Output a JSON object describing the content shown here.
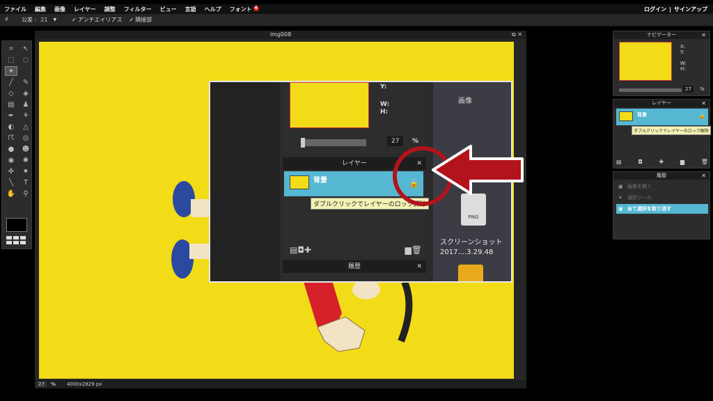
{
  "menu": {
    "items": [
      "ファイル",
      "編集",
      "画像",
      "レイヤー",
      "調整",
      "フィルター",
      "ビュー",
      "言語",
      "ヘルプ",
      "フォント"
    ],
    "font_badge": "4",
    "login": "ログイン",
    "separator": "|",
    "signup": "サインアップ"
  },
  "options": {
    "tolerance_label": "公差 :",
    "tolerance_value": "21",
    "antialias_label": "アンチエイリアス",
    "contiguous_label": "隣接部",
    "check": "✓"
  },
  "canvas": {
    "title": "img008",
    "zoom": "27",
    "zoom_unit": "%",
    "size": "4000x2829 px"
  },
  "navigator": {
    "title": "ナビゲーター",
    "x": "X:",
    "y": "Y:",
    "w": "W:",
    "h": "H:",
    "zoom": "27",
    "zoom_unit": "%"
  },
  "layers": {
    "title": "レイヤー",
    "layer_name": "背景",
    "tooltip": "ダブルクリックでレイヤーのロック解除"
  },
  "history": {
    "title": "履歴",
    "items": [
      "画像を開く",
      "選択ツール",
      "全て選択を取り消す"
    ]
  },
  "zoom_overlay": {
    "y": "Y:",
    "w": "W:",
    "h": "H:",
    "zoom": "27",
    "zoom_unit": "%",
    "layers_title": "レイヤー",
    "layer_name": "背景",
    "tooltip": "ダブルクリックでレイヤーのロック解除",
    "history_title": "履歴",
    "bg_title": "画像",
    "png_label": "PNG",
    "screenshot_label": "スクリーンショット 2017....3.29.48"
  },
  "colors": {
    "canvas_yellow": "#f2dc17",
    "layer_blue": "#56b7d3",
    "annotation_red": "#b3131b",
    "tooltip_bg": "#f4f2b4"
  }
}
